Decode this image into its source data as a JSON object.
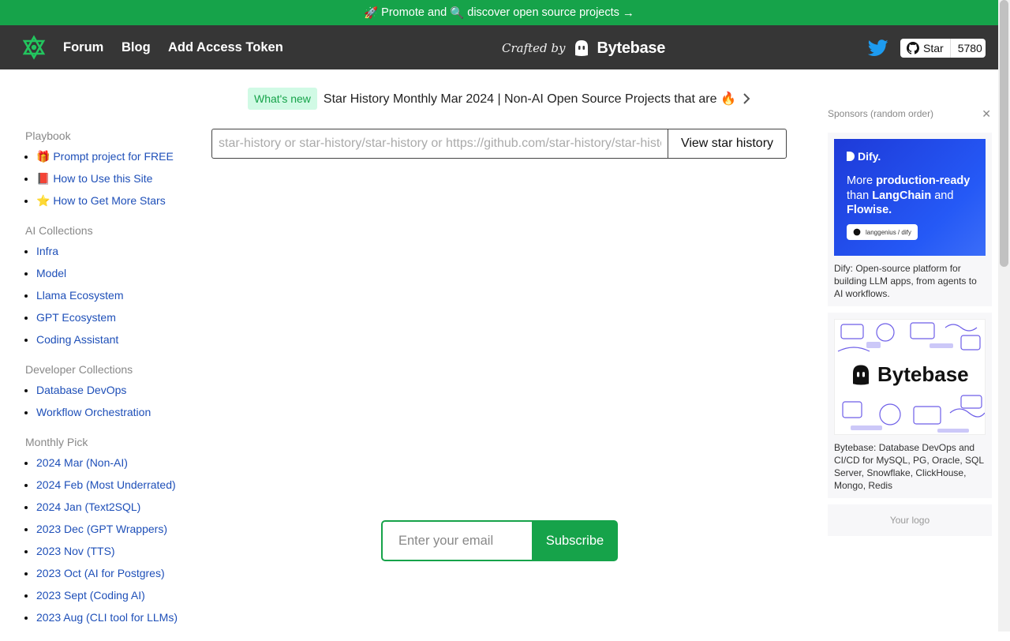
{
  "promo": {
    "rocket": "🚀",
    "text1": "Promote and",
    "magnifier": "🔍",
    "text2": "discover open source projects",
    "arrow": "→"
  },
  "header": {
    "nav": [
      "Forum",
      "Blog",
      "Add Access Token"
    ],
    "crafted_by": "Crafted by",
    "brand": "Bytebase",
    "github": {
      "label": "Star",
      "count": "5780"
    }
  },
  "whats_new": {
    "badge": "What's new",
    "title": "Star History Monthly Mar 2024 | Non-AI Open Source Projects that are 🔥",
    "chevron": "›"
  },
  "search": {
    "placeholder": "star-history or star-history/star-history or https://github.com/star-history/star-history",
    "button": "View star history"
  },
  "sidebar": {
    "playbook": {
      "title": "Playbook",
      "items": [
        "🎁 Prompt project for FREE",
        "📕 How to Use this Site",
        "⭐ How to Get More Stars"
      ]
    },
    "ai": {
      "title": "AI Collections",
      "items": [
        "Infra",
        "Model",
        "Llama Ecosystem",
        "GPT Ecosystem",
        "Coding Assistant"
      ]
    },
    "dev": {
      "title": "Developer Collections",
      "items": [
        "Database DevOps",
        "Workflow Orchestration"
      ]
    },
    "monthly": {
      "title": "Monthly Pick",
      "items": [
        "2024 Mar (Non-AI)",
        "2024 Feb (Most Underrated)",
        "2024 Jan (Text2SQL)",
        "2023 Dec (GPT Wrappers)",
        "2023 Nov (TTS)",
        "2023 Oct (AI for Postgres)",
        "2023 Sept (Coding AI)",
        "2023 Aug (CLI tool for LLMs)"
      ]
    }
  },
  "subscribe": {
    "placeholder": "Enter your email",
    "button": "Subscribe"
  },
  "sponsors": {
    "title": "Sponsors (random order)",
    "close": "✕",
    "dify": {
      "logo": "Dify.",
      "tag_pre": "More",
      "tag_bold": "production-ready",
      "tag_mid": "than",
      "tag_bold2": "LangChain",
      "tag_and": "and",
      "tag_bold3": "Flowise.",
      "pill": "langgenius / dify",
      "desc": "Dify: Open-source platform for building LLM apps, from agents to AI workflows."
    },
    "bytebase": {
      "word": "Bytebase",
      "desc": "Bytebase: Database DevOps and CI/CD for MySQL, PG, Oracle, SQL Server, Snowflake, ClickHouse, Mongo, Redis"
    },
    "your_logo": "Your logo"
  },
  "colors": {
    "accent": "#16a34a",
    "header": "#363636",
    "link": "#1e4fb8"
  }
}
